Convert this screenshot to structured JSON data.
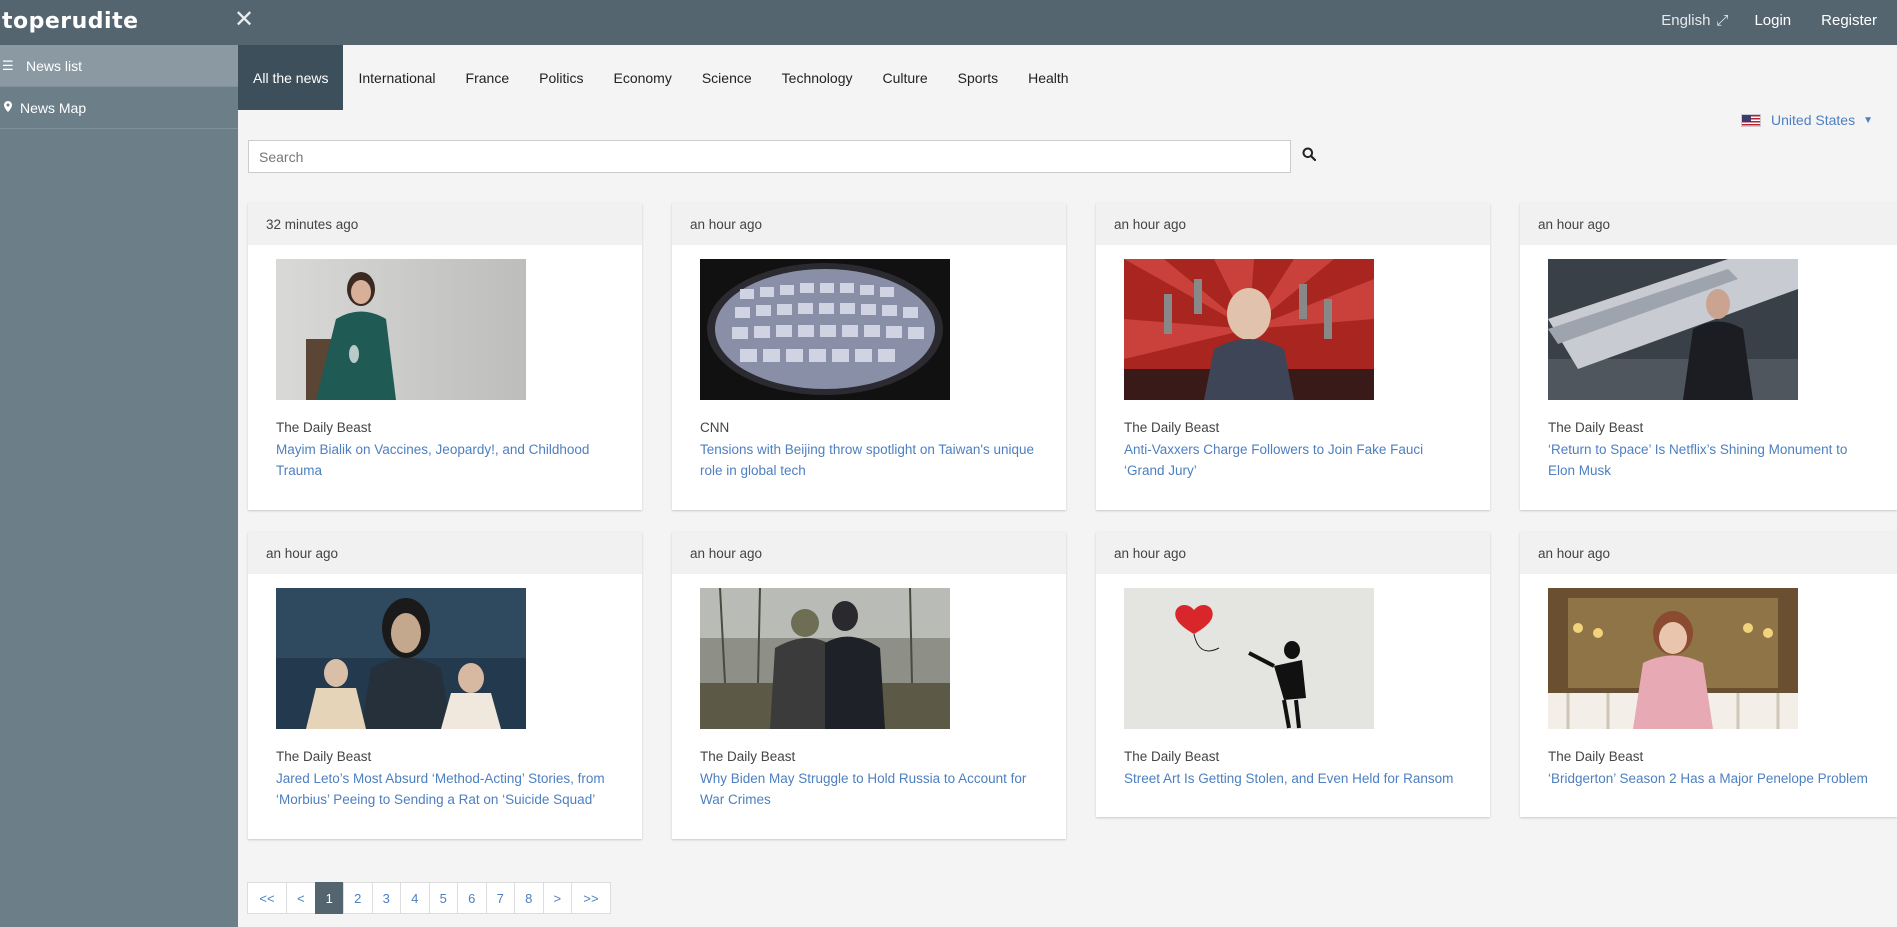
{
  "brand": {
    "logo_text": "toperudite"
  },
  "topbar": {
    "language": "English",
    "login": "Login",
    "register": "Register"
  },
  "sidebar": {
    "items": [
      {
        "label": "News list"
      },
      {
        "label": "News Map"
      }
    ]
  },
  "tabs": [
    "All the news",
    "International",
    "France",
    "Politics",
    "Economy",
    "Science",
    "Technology",
    "Culture",
    "Sports",
    "Health"
  ],
  "country": {
    "selected": "United States"
  },
  "search": {
    "placeholder": "Search"
  },
  "cards": [
    {
      "time": "32 minutes ago",
      "source": "The Daily Beast",
      "title": "Mayim Bialik on Vaccines, Jeopardy!, and Childhood Trauma"
    },
    {
      "time": "an hour ago",
      "source": "CNN",
      "title": "Tensions with Beijing throw spotlight on Taiwan's unique role in global tech"
    },
    {
      "time": "an hour ago",
      "source": "The Daily Beast",
      "title": "Anti-Vaxxers Charge Followers to Join Fake Fauci ‘Grand Jury’"
    },
    {
      "time": "an hour ago",
      "source": "The Daily Beast",
      "title": "‘Return to Space’ Is Netflix’s Shining Monument to Elon Musk"
    },
    {
      "time": "an hour ago",
      "source": "The Daily Beast",
      "title": "Jared Leto’s Most Absurd ‘Method-Acting’ Stories, from ‘Morbius’ Peeing to Sending a Rat on ‘Suicide Squad’"
    },
    {
      "time": "an hour ago",
      "source": "The Daily Beast",
      "title": "Why Biden May Struggle to Hold Russia to Account for War Crimes"
    },
    {
      "time": "an hour ago",
      "source": "The Daily Beast",
      "title": "Street Art Is Getting Stolen, and Even Held for Ransom"
    },
    {
      "time": "an hour ago",
      "source": "The Daily Beast",
      "title": "‘Bridgerton’ Season 2 Has a Major Penelope Problem"
    }
  ],
  "pagination": {
    "first": "<<",
    "prev": "<",
    "pages": [
      "1",
      "2",
      "3",
      "4",
      "5",
      "6",
      "7",
      "8"
    ],
    "current": "1",
    "next": ">",
    "last": ">>"
  },
  "icons": {
    "close": "close-icon",
    "expand": "expand-icon",
    "list": "list-icon",
    "map_marker": "map-marker-icon",
    "search": "search-icon",
    "flag": "us-flag-icon",
    "caret": "caret-down-icon"
  }
}
